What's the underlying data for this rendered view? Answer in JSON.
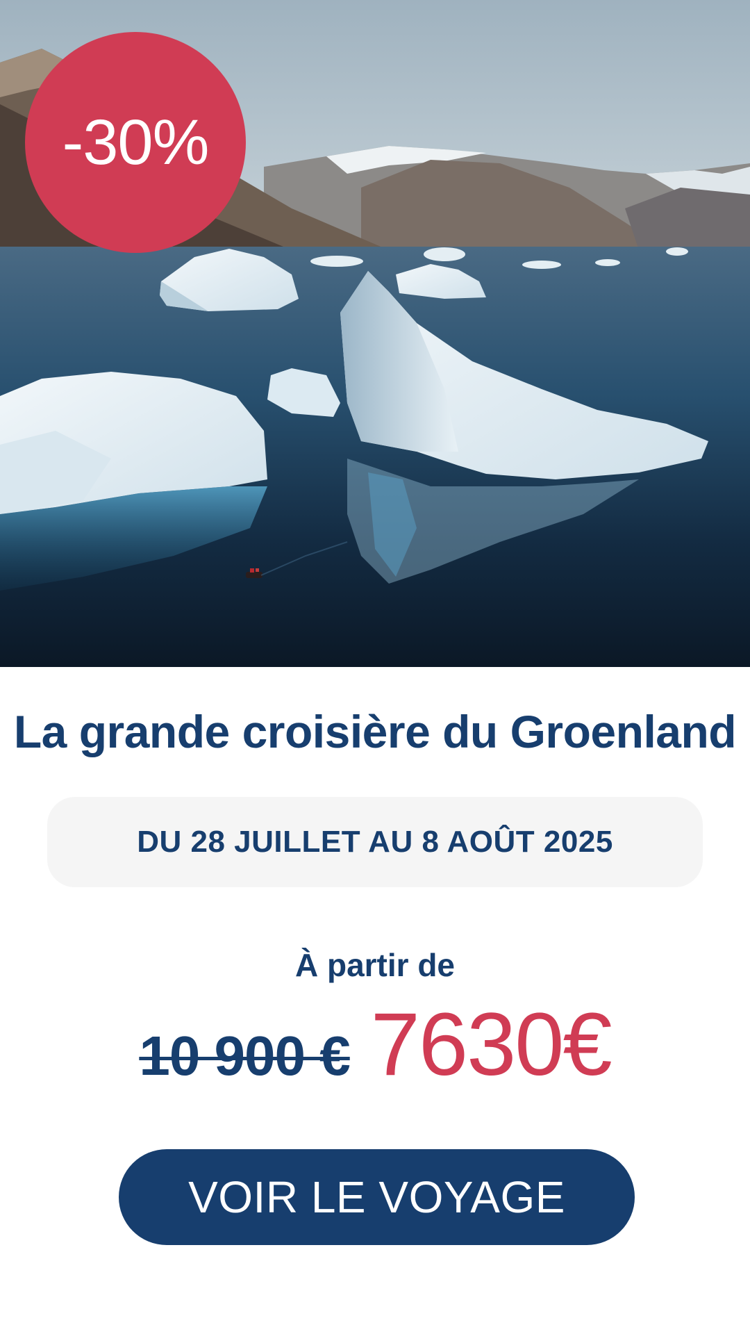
{
  "hero": {
    "image_alt": "Icebergs in a Greenland fjord",
    "discount_badge": "-30%"
  },
  "offer": {
    "title": "La grande croisière du Groenland",
    "dates": "DU 28 JUILLET AU 8 AOÛT 2025",
    "from_label": "À partir de",
    "old_price": "10 900 €",
    "new_price": "7630€"
  },
  "cta": {
    "label": "VOIR LE VOYAGE"
  },
  "colors": {
    "navy": "#173e6e",
    "accent_red": "#d03c54",
    "pill_bg": "#f5f5f5"
  }
}
